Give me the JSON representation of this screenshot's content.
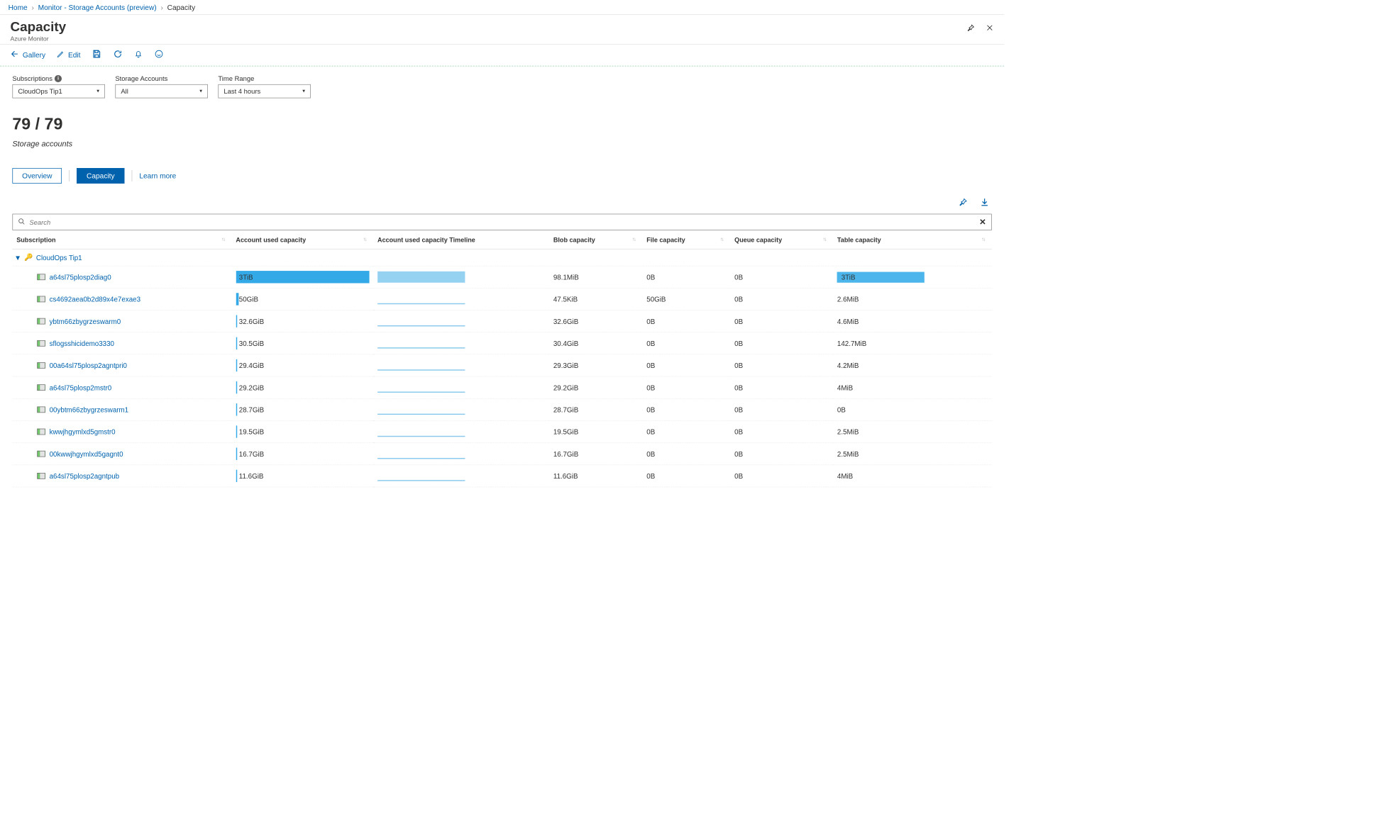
{
  "breadcrumbs": {
    "home": "Home",
    "mid": "Monitor - Storage Accounts (preview)",
    "current": "Capacity"
  },
  "header": {
    "title": "Capacity",
    "subtitle": "Azure Monitor"
  },
  "toolbar": {
    "gallery": "Gallery",
    "edit": "Edit"
  },
  "filters": {
    "subscriptions_label": "Subscriptions",
    "subscriptions_value": "CloudOps Tip1",
    "storage_label": "Storage Accounts",
    "storage_value": "All",
    "time_label": "Time Range",
    "time_value": "Last 4 hours"
  },
  "count": {
    "value": "79 / 79",
    "caption": "Storage accounts"
  },
  "tabs": {
    "overview": "Overview",
    "capacity": "Capacity",
    "learn": "Learn more"
  },
  "search": {
    "placeholder": "Search"
  },
  "columns": {
    "c0": "Subscription",
    "c1": "Account used capacity",
    "c2": "Account used capacity Timeline",
    "c3": "Blob capacity",
    "c4": "File capacity",
    "c5": "Queue capacity",
    "c6": "Table capacity"
  },
  "group": {
    "name": "CloudOps Tip1"
  },
  "rows": [
    {
      "name": "a64sl75plosp2diag0",
      "used": "3TiB",
      "used_pct": 100,
      "tl_hl": true,
      "blob": "98.1MiB",
      "file": "0B",
      "queue": "0B",
      "table": "3TiB",
      "table_hl": true
    },
    {
      "name": "cs4692aea0b2d89x4e7exae3",
      "used": "50GiB",
      "used_pct": 2,
      "tl_hl": false,
      "blob": "47.5KiB",
      "file": "50GiB",
      "queue": "0B",
      "table": "2.6MiB",
      "table_hl": false
    },
    {
      "name": "ybtm66zbygrzeswarm0",
      "used": "32.6GiB",
      "used_pct": 1,
      "tl_hl": false,
      "blob": "32.6GiB",
      "file": "0B",
      "queue": "0B",
      "table": "4.6MiB",
      "table_hl": false
    },
    {
      "name": "sflogsshicidemo3330",
      "used": "30.5GiB",
      "used_pct": 1,
      "tl_hl": false,
      "blob": "30.4GiB",
      "file": "0B",
      "queue": "0B",
      "table": "142.7MiB",
      "table_hl": false
    },
    {
      "name": "00a64sl75plosp2agntpri0",
      "used": "29.4GiB",
      "used_pct": 1,
      "tl_hl": false,
      "blob": "29.3GiB",
      "file": "0B",
      "queue": "0B",
      "table": "4.2MiB",
      "table_hl": false
    },
    {
      "name": "a64sl75plosp2mstr0",
      "used": "29.2GiB",
      "used_pct": 1,
      "tl_hl": false,
      "blob": "29.2GiB",
      "file": "0B",
      "queue": "0B",
      "table": "4MiB",
      "table_hl": false
    },
    {
      "name": "00ybtm66zbygrzeswarm1",
      "used": "28.7GiB",
      "used_pct": 1,
      "tl_hl": false,
      "blob": "28.7GiB",
      "file": "0B",
      "queue": "0B",
      "table": "0B",
      "table_hl": false
    },
    {
      "name": "kwwjhgymlxd5gmstr0",
      "used": "19.5GiB",
      "used_pct": 1,
      "tl_hl": false,
      "blob": "19.5GiB",
      "file": "0B",
      "queue": "0B",
      "table": "2.5MiB",
      "table_hl": false
    },
    {
      "name": "00kwwjhgymlxd5gagnt0",
      "used": "16.7GiB",
      "used_pct": 1,
      "tl_hl": false,
      "blob": "16.7GiB",
      "file": "0B",
      "queue": "0B",
      "table": "2.5MiB",
      "table_hl": false
    },
    {
      "name": "a64sl75plosp2agntpub",
      "used": "11.6GiB",
      "used_pct": 1,
      "tl_hl": false,
      "blob": "11.6GiB",
      "file": "0B",
      "queue": "0B",
      "table": "4MiB",
      "table_hl": false
    }
  ]
}
